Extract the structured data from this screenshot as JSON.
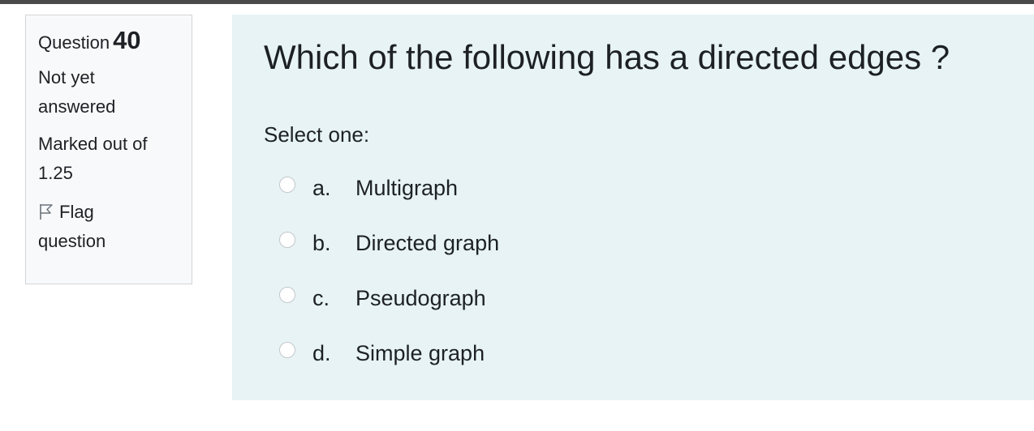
{
  "info": {
    "question_word": "Question",
    "question_number": "40",
    "status_line1": "Not yet",
    "status_line2": "answered",
    "marked_line1": "Marked out of",
    "marked_line2": "1.25",
    "flag_line1": "Flag",
    "flag_line2": "question",
    "flag_icon": "flag-outline-icon"
  },
  "question": {
    "text": "Which of the following has a directed edges ?",
    "prompt": "Select one:",
    "options": [
      {
        "letter": "a.",
        "label": "Multigraph"
      },
      {
        "letter": "b.",
        "label": "Directed graph"
      },
      {
        "letter": "c.",
        "label": "Pseudograph"
      },
      {
        "letter": "d.",
        "label": "Simple graph"
      }
    ]
  },
  "colors": {
    "content_background": "#e7f3f5",
    "info_background": "#f8f9fa",
    "text": "#1d2125"
  }
}
